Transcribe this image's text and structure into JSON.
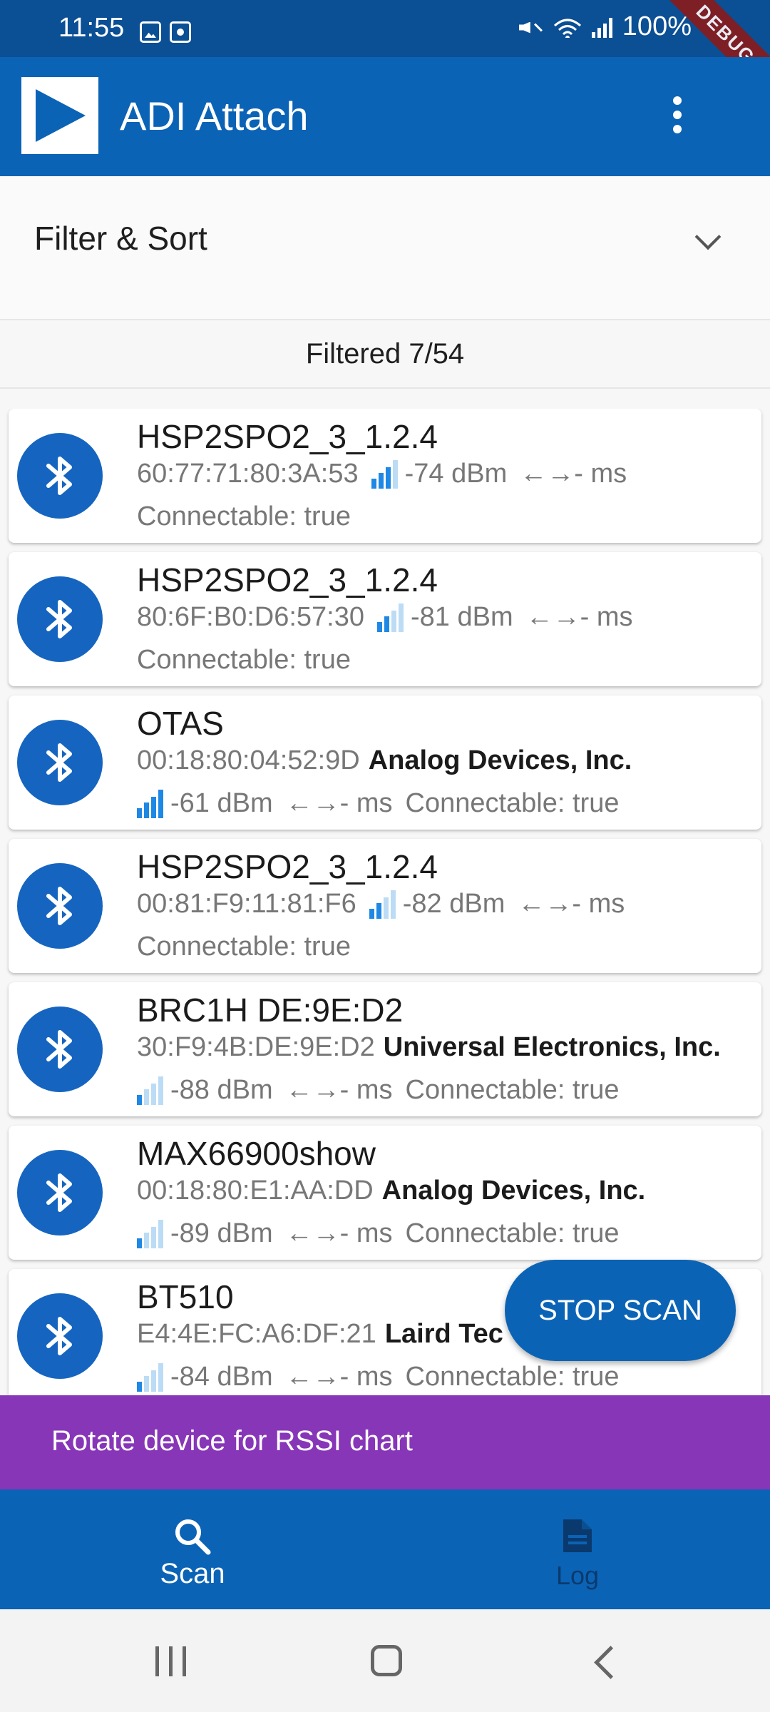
{
  "status_bar": {
    "time": "11:55",
    "battery": "100%",
    "icons": [
      "image-icon",
      "screen-record-icon",
      "mute-icon",
      "wifi-icon",
      "cell-signal-icon"
    ]
  },
  "debug_banner": "DEBUG",
  "app_bar": {
    "title": "ADI Attach",
    "logo": "adi-logo-icon",
    "menu_icon": "more-vert-icon"
  },
  "filter": {
    "label": "Filter & Sort",
    "icon": "chevron-down-icon"
  },
  "filtered_count": "Filtered 7/54",
  "devices": [
    {
      "name": "HSP2SPO2_3_1.2.4",
      "address": "60:77:71:80:3A:53",
      "manufacturer": "",
      "rssi": "-74 dBm",
      "signal_bars": 3,
      "latency": "←→- ms",
      "connectable": "Connectable: true"
    },
    {
      "name": "HSP2SPO2_3_1.2.4",
      "address": "80:6F:B0:D6:57:30",
      "manufacturer": "",
      "rssi": "-81 dBm",
      "signal_bars": 2,
      "latency": "←→- ms",
      "connectable": "Connectable: true"
    },
    {
      "name": "OTAS",
      "address": "00:18:80:04:52:9D",
      "manufacturer": "Analog Devices, Inc.",
      "rssi": "-61 dBm",
      "signal_bars": 4,
      "latency": "←→- ms",
      "connectable": "Connectable: true"
    },
    {
      "name": "HSP2SPO2_3_1.2.4",
      "address": "00:81:F9:11:81:F6",
      "manufacturer": "",
      "rssi": "-82 dBm",
      "signal_bars": 2,
      "latency": "←→- ms",
      "connectable": "Connectable: true"
    },
    {
      "name": "BRC1H DE:9E:D2",
      "address": "30:F9:4B:DE:9E:D2",
      "manufacturer": "Universal Electronics, Inc.",
      "rssi": "-88 dBm",
      "signal_bars": 1,
      "latency": "←→- ms",
      "connectable": "Connectable: true"
    },
    {
      "name": "MAX66900show",
      "address": "00:18:80:E1:AA:DD",
      "manufacturer": "Analog Devices, Inc.",
      "rssi": "-89 dBm",
      "signal_bars": 1,
      "latency": "←→- ms",
      "connectable": "Connectable: true"
    },
    {
      "name": "BT510",
      "address": "E4:4E:FC:A6:DF:21",
      "manufacturer": "Laird Tec",
      "rssi": "-84 dBm",
      "signal_bars": 1,
      "latency": "←→- ms",
      "connectable": "Connectable: true"
    }
  ],
  "fab": {
    "label": "STOP SCAN"
  },
  "snackbar": {
    "text": "Rotate device for RSSI chart"
  },
  "bottom_nav": {
    "scan": {
      "label": "Scan",
      "icon": "search-icon",
      "selected": true
    },
    "log": {
      "label": "Log",
      "icon": "document-icon",
      "selected": false
    }
  },
  "system_nav": [
    "recent-apps-icon",
    "home-icon",
    "back-icon"
  ],
  "colors": {
    "primary": "#0b63b6",
    "status_bar": "#0b4f94",
    "bluetooth_circle": "#1565c0",
    "signal_on": "#1e88e5",
    "signal_off": "#bcdcf5",
    "snackbar": "#8736b8"
  }
}
